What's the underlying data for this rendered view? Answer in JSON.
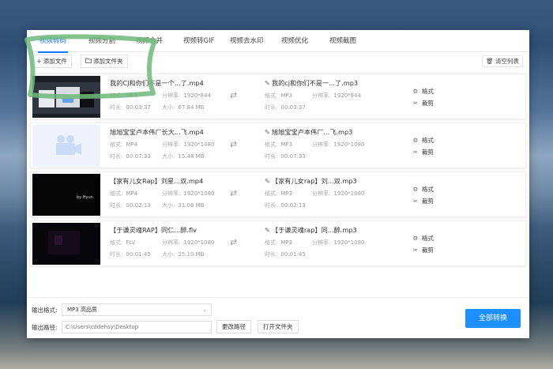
{
  "tabs": [
    {
      "label": "视频转码",
      "active": true
    },
    {
      "label": "视频分割"
    },
    {
      "label": "视频合并"
    },
    {
      "label": "视频转GIF"
    },
    {
      "label": "视频去水印"
    },
    {
      "label": "视频优化"
    },
    {
      "label": "视频截图"
    }
  ],
  "toolbar": {
    "add_file": "添加文件",
    "add_folder": "添加文件夹",
    "clear_list": "清空列表"
  },
  "meta_keys": {
    "format": "格式:",
    "resolution": "分辨率:",
    "duration": "时长:",
    "size": "大小:"
  },
  "actions": {
    "format": "格式",
    "cut": "裁剪"
  },
  "files": [
    {
      "src_name": "我的CJ和你们不是一个...了.mp4",
      "src_format": "MP4",
      "src_res": "1920*844",
      "src_duration": "00:03:37",
      "src_size": "67.84 MB",
      "dst_name": "我的cj和你们不是一...了.mp3",
      "dst_format": "MP3",
      "dst_res": "1920*844",
      "dst_duration": "00:03:37"
    },
    {
      "src_name": "旭旭宝宝卢本伟厂长大...飞.mp4",
      "src_format": "MP4",
      "src_res": "1920*1080",
      "src_duration": "00:07:33",
      "src_size": "15.48 MB",
      "dst_name": "旭旭宝宝卢本伟厂...飞.mp3",
      "dst_format": "MP3",
      "dst_res": "1920*1080",
      "dst_duration": "00:07:33"
    },
    {
      "src_name": "【家有儿女Rap】刘星...双.mp4",
      "src_format": "MP4",
      "src_res": "1920*1080",
      "src_duration": "00:02:13",
      "src_size": "31.08 MB",
      "dst_name": "【家有儿女rap】刘...双.mp3",
      "dst_format": "MP3",
      "dst_res": "1920*1080",
      "dst_duration": "00:02:13",
      "thumb_text": "by Hyun"
    },
    {
      "src_name": "【于谦灵魂RAP】同仁...醉.flv",
      "src_format": "FLV",
      "src_res": "1920*1080",
      "src_duration": "00:01:45",
      "src_size": "25.10 MB",
      "dst_name": "【于谦灵魂rap】同...醉.mp3",
      "dst_format": "MP3",
      "dst_res": "1920*1080",
      "dst_duration": "00:01:45"
    }
  ],
  "bottom": {
    "output_format_label": "输出格式:",
    "output_format_value": "MP3  高品质",
    "output_path_label": "输出路径:",
    "output_path_value": "C:\\Users\\cddehsy\\Desktop",
    "change_path": "更改路径",
    "open_folder": "打开文件夹",
    "convert_all": "全部转换"
  },
  "colors": {
    "accent": "#1677ff",
    "convert_button": "#1e8fff",
    "highlight_annotation": "#6fb87a"
  }
}
